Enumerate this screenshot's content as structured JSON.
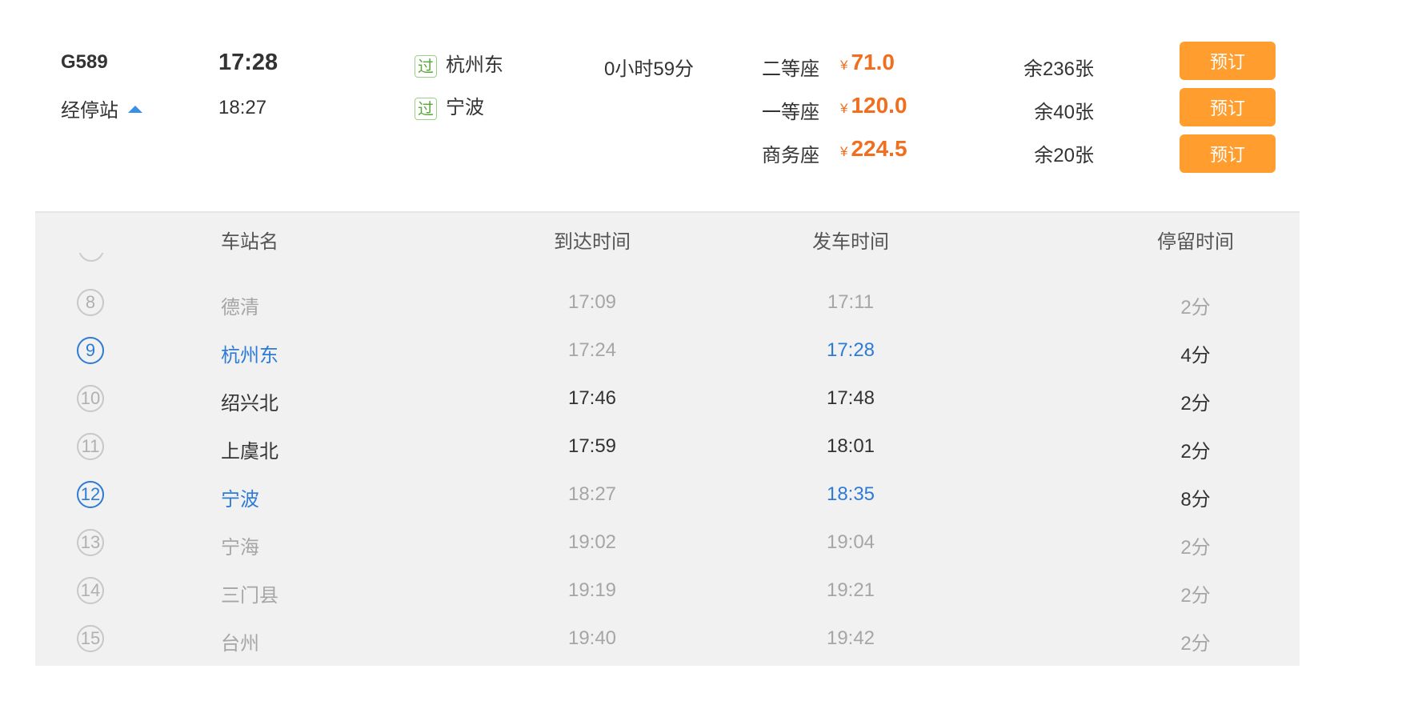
{
  "train": {
    "number": "G589",
    "stops_toggle_label": "经停站",
    "departure_time": "17:28",
    "arrival_time": "18:27",
    "from_badge": "过",
    "from_station": "杭州东",
    "to_badge": "过",
    "to_station": "宁波",
    "duration": "0小时59分"
  },
  "seats": [
    {
      "name": "二等座",
      "currency": "¥",
      "price": "71.0",
      "remaining": "余236张",
      "book_label": "预订"
    },
    {
      "name": "一等座",
      "currency": "¥",
      "price": "120.0",
      "remaining": "余40张",
      "book_label": "预订"
    },
    {
      "name": "商务座",
      "currency": "¥",
      "price": "224.5",
      "remaining": "余20张",
      "book_label": "预订"
    }
  ],
  "stops_table": {
    "headers": {
      "station": "车站名",
      "arrival": "到达时间",
      "departure": "发车时间",
      "stay": "停留时间"
    },
    "rows": [
      {
        "no": "8",
        "station": "德清",
        "arrival": "17:09",
        "departure": "17:11",
        "stay": "2分"
      },
      {
        "no": "9",
        "station": "杭州东",
        "arrival": "17:24",
        "departure": "17:28",
        "stay": "4分"
      },
      {
        "no": "10",
        "station": "绍兴北",
        "arrival": "17:46",
        "departure": "17:48",
        "stay": "2分"
      },
      {
        "no": "11",
        "station": "上虞北",
        "arrival": "17:59",
        "departure": "18:01",
        "stay": "2分"
      },
      {
        "no": "12",
        "station": "宁波",
        "arrival": "18:27",
        "departure": "18:35",
        "stay": "8分"
      },
      {
        "no": "13",
        "station": "宁海",
        "arrival": "19:02",
        "departure": "19:04",
        "stay": "2分"
      },
      {
        "no": "14",
        "station": "三门县",
        "arrival": "19:19",
        "departure": "19:21",
        "stay": "2分"
      },
      {
        "no": "15",
        "station": "台州",
        "arrival": "19:40",
        "departure": "19:42",
        "stay": "2分"
      }
    ]
  },
  "colors": {
    "price": "#f06e1e",
    "book_button": "#ff9d2e",
    "passing_station": "#2e7bd6",
    "badge_green": "#5aa83a",
    "panel_bg": "#f1f1f1"
  },
  "icons": {
    "stops_toggle": "caret-up-icon",
    "station_badge": "pass-badge-icon"
  }
}
